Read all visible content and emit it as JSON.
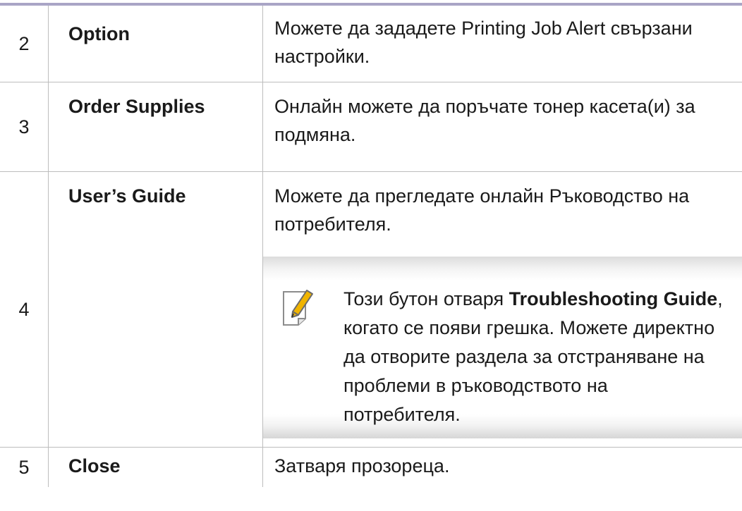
{
  "rows": [
    {
      "num": "2",
      "name": "Option",
      "desc": "Можете да зададете Printing Job Alert свързани настройки."
    },
    {
      "num": "3",
      "name": "Order Supplies",
      "desc": "Онлайн можете да поръчате тонер касета(и) за подмяна."
    },
    {
      "num": "4",
      "name": "User’s Guide",
      "desc": "Можете да прегледате онлайн Ръководство на потребителя.",
      "note": {
        "icon": "note-pencil-icon",
        "text_before": "Този бутон отваря ",
        "bold_term": "Troubleshooting Guide",
        "text_after": ", когато се появи грешка. Можете директно да отворите раздела за отстраняване на проблеми в ръководството на потребителя."
      }
    },
    {
      "num": "5",
      "name": "Close",
      "desc": "Затваря прозореца."
    }
  ],
  "colors": {
    "top_rule": "#a9a5c6",
    "grid_line": "#bdbdbd",
    "note_icon_accent": "#f0b400"
  }
}
